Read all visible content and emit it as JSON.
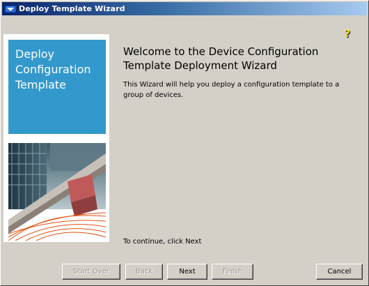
{
  "window": {
    "title": "Deploy Template Wizard"
  },
  "side_panel": {
    "title": "Deploy\nConfiguration\nTemplate"
  },
  "main": {
    "heading": "Welcome to the Device Configuration\nTemplate Deployment Wizard",
    "description": "This Wizard will help you deploy a configuration template to a group of devices.",
    "continue_text": "To continue, click Next"
  },
  "buttons": {
    "start_over": "Start Over",
    "back": "Back",
    "next": "Next",
    "finish": "Finish",
    "cancel": "Cancel"
  },
  "colors": {
    "accent": "#3399cc",
    "titlebar_start": "#0a246a",
    "titlebar_end": "#a6caf0",
    "help_icon": "#f2e600"
  },
  "icons": {
    "window_icon": "app-icon",
    "help": "help-icon"
  }
}
